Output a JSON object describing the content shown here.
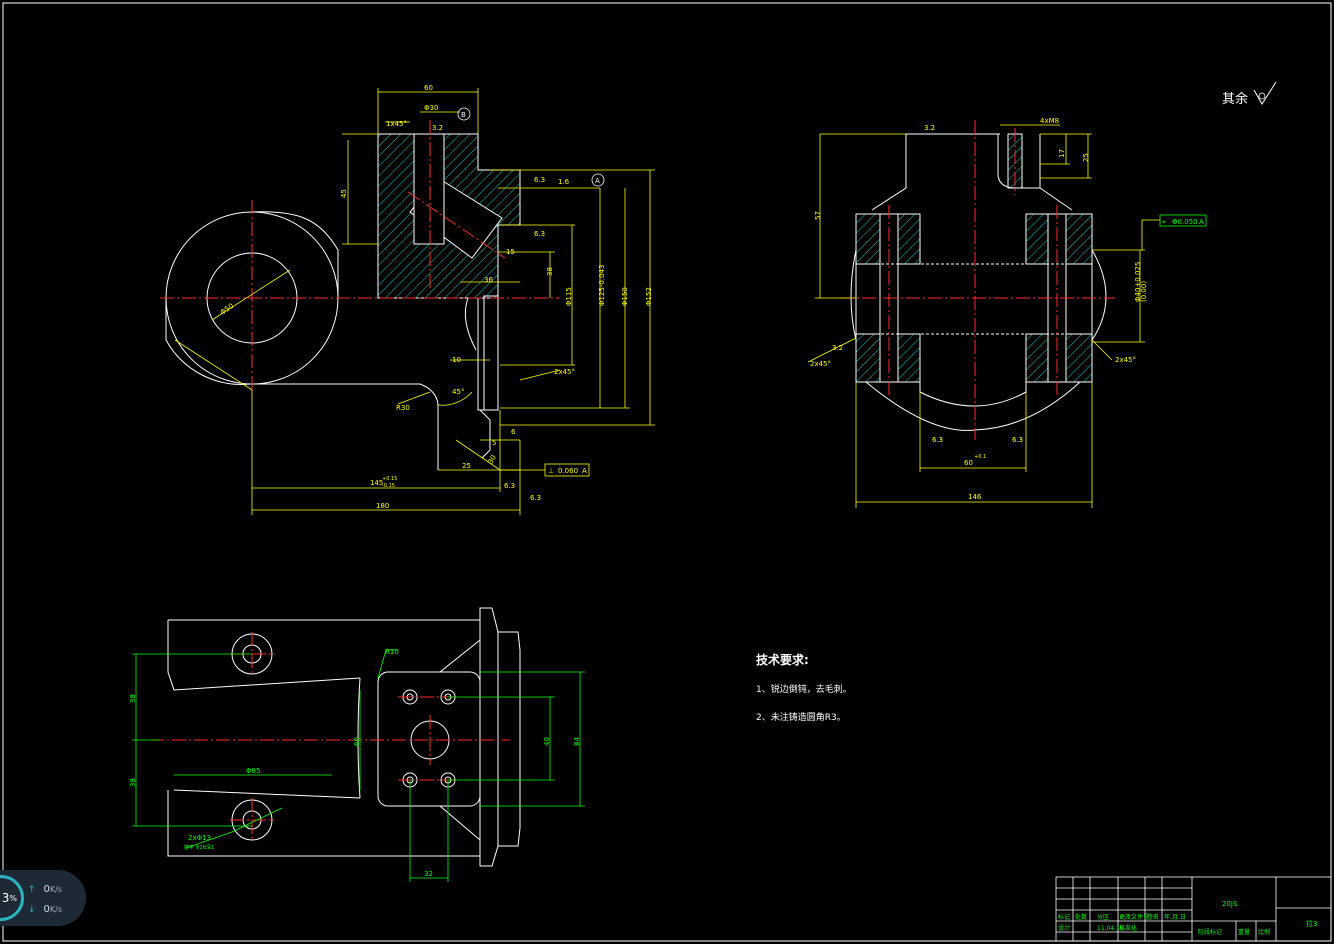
{
  "surface_note": {
    "text": "其余"
  },
  "tech_requirements": {
    "title": "技术要求:",
    "item1": "1、锐边倒钝，去毛刺。",
    "item2": "2、未注铸造圆角R3。"
  },
  "front_view": {
    "dims": {
      "top_width": "60",
      "bore_dia": "Φ30",
      "datum_b": "B",
      "chamfer_top": "1x45°",
      "ra_top": "3.2",
      "height_45": "45",
      "datum_a": "A",
      "ra_right1": "6.3",
      "ra_right2": "1.6",
      "ra_side": "6.3",
      "dim_15": "15",
      "dim_36": "36",
      "dim_38": "38",
      "dim_h7": "Φ115",
      "dim_fit": "Φ125-0.043",
      "dim_150": "Φ150",
      "dim_152": "Φ152",
      "angle_45": "45°",
      "r30": "R30",
      "dim_10": "10",
      "chamfer_low": "2x45°",
      "dim_6": "6",
      "dim_25": "25",
      "dim_145": "145",
      "tol_145": "+0.15",
      "tol_145b": "-0.15",
      "ra_low1": "6.3",
      "ra_low2": "6.3",
      "overall_180": "180",
      "phi_left": "Φ50",
      "dim_30": "30",
      "dim_5": "5",
      "flat_tol_sym": "⊥",
      "flat_tol_val": "0.060",
      "flat_tol_datum": "A"
    }
  },
  "side_view": {
    "dims": {
      "ra_top": "3.2",
      "dim_4x_m8": "4xM8",
      "dim_57": "57",
      "dim_17": "17",
      "dim_25": "25",
      "pos_tol_sym": "⌖",
      "pos_tol_val": "Φ0.050",
      "pos_tol_datum": "A",
      "bore_fit": "Φ40+0.025",
      "bore_fit2": "(0.00)",
      "chamfer_left": "2x45°",
      "ra_left": "3.2",
      "chamfer_right": "2x45°",
      "ra_bot1": "6.3",
      "ra_bot2": "6.3",
      "dim_60": "60",
      "tol_60": "+0.1",
      "dim_146": "146"
    }
  },
  "plan_view": {
    "dims": {
      "r10": "R10",
      "dim_38a": "38",
      "dim_38b": "38",
      "dim_60": "60",
      "dim_40": "40",
      "dim_84": "84",
      "dim_95": "Φ85",
      "dim_32": "32",
      "holes_label": "2xΦ13",
      "holes_sub": "锪平 Φ26深1"
    }
  },
  "title_block": {
    "part_code": "20JS",
    "name": "",
    "row_marks": "标记",
    "row_qty": "处数",
    "row_zone": "分区",
    "row_doc": "更改文件号",
    "row_sign": "签名",
    "row_date": "年.月.日",
    "design": "设计",
    "date_val": "11.04.10",
    "standard": "标准化",
    "stage_mark": "阶段标记",
    "weight": "重量",
    "scale": "比例",
    "material": "拉3"
  },
  "net_widget": {
    "percent": "3",
    "percent_sign": "%",
    "up_rate": "0",
    "up_unit": "K/s",
    "down_rate": "0",
    "down_unit": "K/s"
  }
}
